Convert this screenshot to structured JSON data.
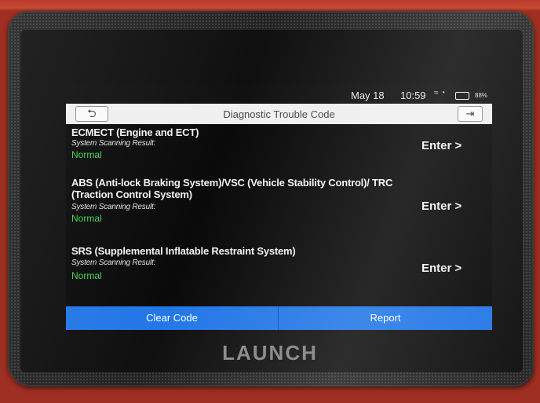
{
  "status": {
    "date": "May 18",
    "time": "10:59",
    "icons": "≈ ◔",
    "battery": "88%"
  },
  "header": {
    "back_icon": "⮌",
    "title": "Diagnostic Trouble Code",
    "exit_icon": "⇥"
  },
  "systems": [
    {
      "name": "ECMECT (Engine and ECT)",
      "sub": "System Scanning Result:",
      "status": "Normal",
      "enter": "Enter >"
    },
    {
      "name": "ABS (Anti-lock Braking System)/VSC (Vehicle Stability Control)/ TRC (Traction Control System)",
      "sub": "System Scanning Result:",
      "status": "Normal",
      "enter": "Enter >"
    },
    {
      "name": "SRS (Supplemental Inflatable Restraint System)",
      "sub": "System Scanning Result:",
      "status": "Normal",
      "enter": "Enter >"
    }
  ],
  "bottom": {
    "clear": "Clear Code",
    "report": "Report"
  },
  "brand": "LAUNCH",
  "colors": {
    "accent": "#1e74e6",
    "status_ok": "#3fd24a"
  }
}
